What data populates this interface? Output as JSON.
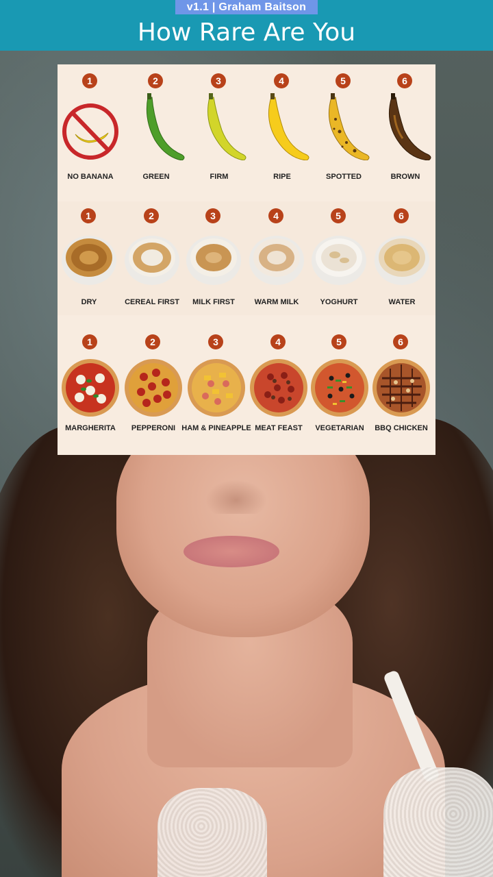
{
  "header": {
    "version_tag": "v1.1 | Graham Baitson",
    "title": "How Rare Are You"
  },
  "rows": [
    {
      "name": "bananas",
      "items": [
        {
          "number": "1",
          "label": "NO BANANA",
          "icon": "no-banana-icon"
        },
        {
          "number": "2",
          "label": "GREEN",
          "icon": "banana-icon",
          "color": "#4e9e2a"
        },
        {
          "number": "3",
          "label": "FIRM",
          "icon": "banana-icon",
          "color": "#c9d52c"
        },
        {
          "number": "4",
          "label": "RIPE",
          "icon": "banana-icon",
          "color": "#f6cc1c"
        },
        {
          "number": "5",
          "label": "SPOTTED",
          "icon": "banana-icon",
          "color": "#eab726"
        },
        {
          "number": "6",
          "label": "BROWN",
          "icon": "banana-icon",
          "color": "#5a3414"
        }
      ]
    },
    {
      "name": "cereal",
      "items": [
        {
          "number": "1",
          "label": "DRY",
          "icon": "cereal-bowl-icon"
        },
        {
          "number": "2",
          "label": "CEREAL FIRST",
          "icon": "cereal-bowl-icon"
        },
        {
          "number": "3",
          "label": "MILK FIRST",
          "icon": "cereal-bowl-icon"
        },
        {
          "number": "4",
          "label": "WARM MILK",
          "icon": "cereal-bowl-icon"
        },
        {
          "number": "5",
          "label": "YOGHURT",
          "icon": "cereal-bowl-icon"
        },
        {
          "number": "6",
          "label": "WATER",
          "icon": "cereal-bowl-icon"
        }
      ]
    },
    {
      "name": "pizza",
      "items": [
        {
          "number": "1",
          "label": "MARGHERITA",
          "icon": "pizza-icon"
        },
        {
          "number": "2",
          "label": "PEPPERONI",
          "icon": "pizza-icon"
        },
        {
          "number": "3",
          "label": "HAM & PINEAPPLE",
          "icon": "pizza-icon"
        },
        {
          "number": "4",
          "label": "MEAT FEAST",
          "icon": "pizza-icon"
        },
        {
          "number": "5",
          "label": "VEGETARIAN",
          "icon": "pizza-icon"
        },
        {
          "number": "6",
          "label": "BBQ CHICKEN",
          "icon": "pizza-icon"
        }
      ]
    }
  ],
  "colors": {
    "header_bg": "#1999b3",
    "version_tag_bg": "#6f96e8",
    "number_badge": "#b8421a",
    "board_bg": "#f8ece0"
  }
}
